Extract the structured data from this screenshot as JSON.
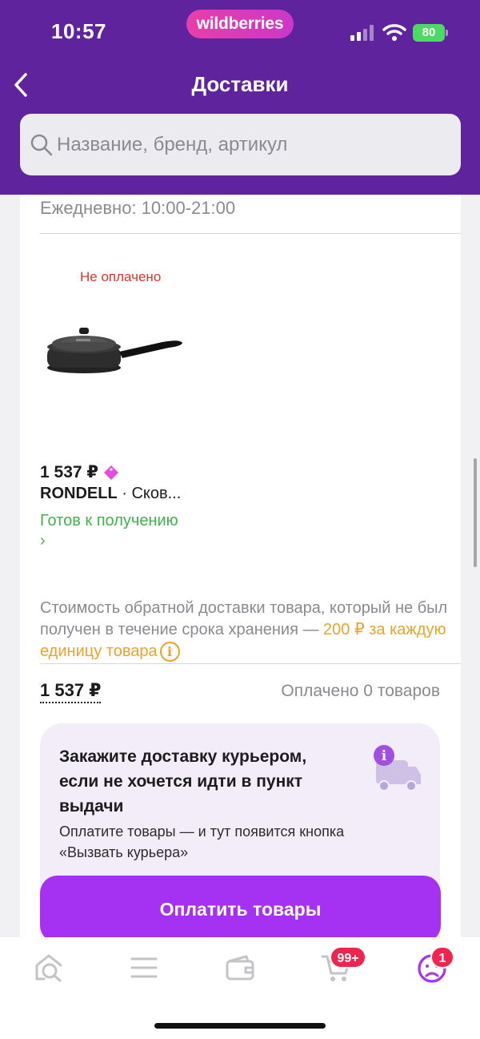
{
  "status_bar": {
    "time": "10:57",
    "battery": "80"
  },
  "brand": {
    "name": "wildberries",
    "accent": "#5e239d",
    "pill_color": "#d93cb8"
  },
  "header": {
    "title": "Доставки",
    "back_icon": "chevron-left-icon"
  },
  "search": {
    "placeholder": "Название, бренд, артикул",
    "icon": "search-icon"
  },
  "pickup": {
    "hours": "Ежедневно: 10:00-21:00"
  },
  "item": {
    "payment_status": "Не оплачено",
    "price": "1 537 ₽",
    "brand": "RONDELL",
    "name_rest": " · Сков...",
    "status": "Готов к получению",
    "status_chevron": "›"
  },
  "return_note": {
    "text": "Стоимость обратной доставки товара, который не был получен в течение срока хранения — ",
    "accent": "200 ₽ за каждую единицу товара",
    "info_glyph": "i"
  },
  "summary": {
    "total": "1 537 ₽",
    "paid": "Оплачено 0 товаров"
  },
  "promo": {
    "title": "Закажите доставку курьером, если не хочется идти в пункт выдачи",
    "text": "Оплатите товары — и тут появится кнопка «Вызвать курьера»",
    "icon_glyph": "i"
  },
  "pay_button": {
    "label": "Оплатить товары",
    "color": "#a532f2"
  },
  "tabbar": {
    "items": [
      {
        "icon": "home-search-icon"
      },
      {
        "icon": "catalog-menu-icon"
      },
      {
        "icon": "wallet-icon"
      },
      {
        "icon": "cart-icon",
        "badge": "99+"
      },
      {
        "icon": "profile-icon",
        "badge": "1"
      }
    ]
  }
}
